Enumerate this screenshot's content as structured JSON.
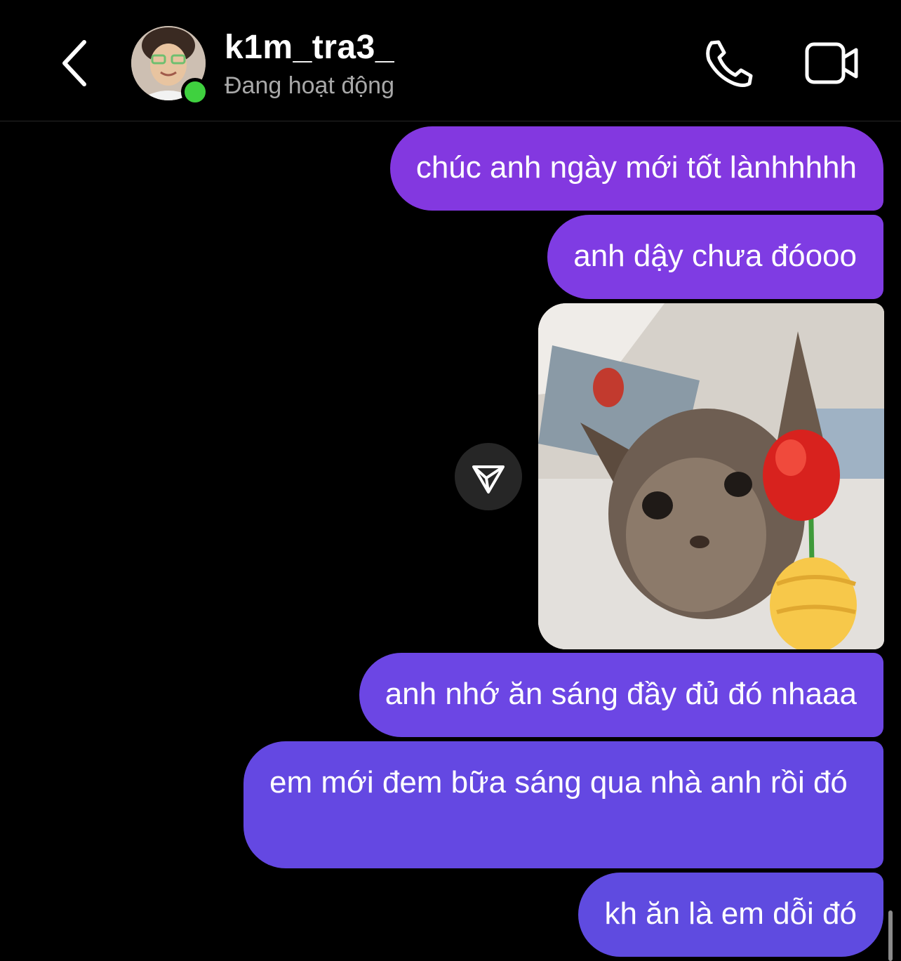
{
  "header": {
    "back_icon": "chevron-left-icon",
    "username": "k1m_tra3_",
    "status": "Đang hoạt động",
    "call_icon": "phone-icon",
    "video_icon": "video-camera-icon"
  },
  "messages": [
    {
      "text": "chúc anh ngày mới tốt lànhhhhh"
    },
    {
      "text": "anh dậy chưa đóooo"
    },
    {
      "image": "kitten holding a rose sticker"
    },
    {
      "text": "anh nhớ ăn sáng đầy đủ đó nhaaa"
    },
    {
      "text": "em mới đem bữa sáng qua nhà anh rồi đó"
    },
    {
      "text": "kh ăn là em dỗi đó"
    }
  ],
  "share_icon": "send-icon",
  "colors": {
    "background": "#000000",
    "bubble_top": "#8338e0",
    "bubble_bottom": "#5f4be0",
    "online": "#3fd13f",
    "status_text": "#a8a8a8"
  }
}
